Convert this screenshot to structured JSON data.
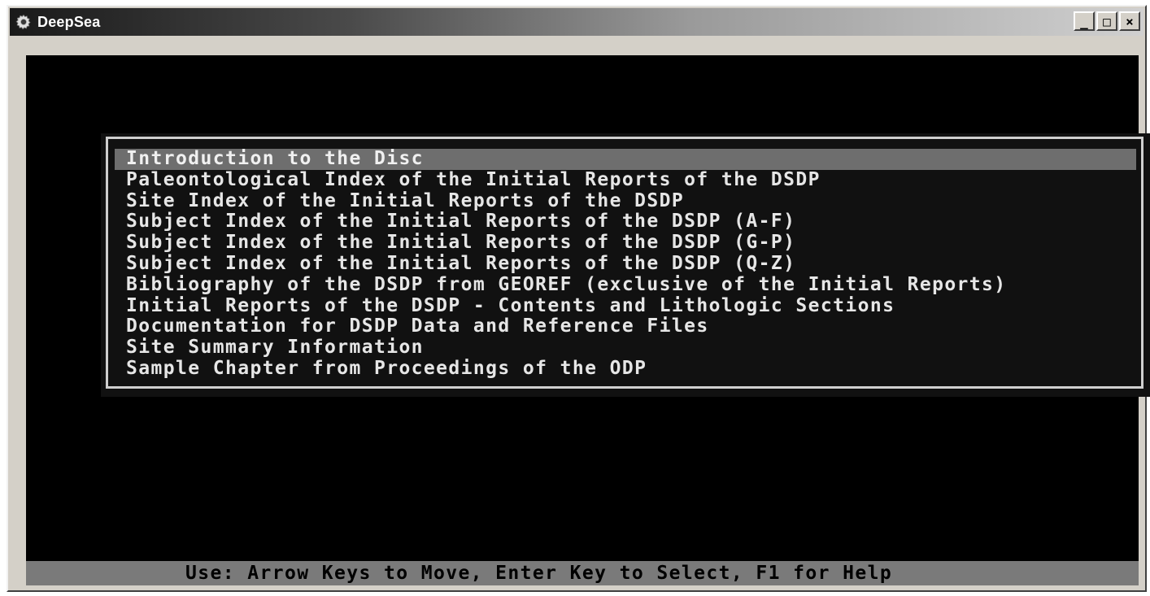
{
  "window": {
    "title": "DeepSea",
    "minimize_label": "_",
    "maximize_label": "□",
    "close_label": "×"
  },
  "menu": {
    "selected_index": 0,
    "items": [
      "Introduction to the Disc",
      "Paleontological Index of the Initial Reports of the DSDP",
      "Site Index of the Initial Reports of the DSDP",
      "Subject Index of the Initial Reports of the DSDP (A-F)",
      "Subject Index of the Initial Reports of the DSDP (G-P)",
      "Subject Index of the Initial Reports of the DSDP (Q-Z)",
      "Bibliography of the DSDP from GEOREF (exclusive of the Initial Reports)",
      "Initial Reports of the DSDP - Contents and Lithologic Sections",
      "Documentation for DSDP Data and Reference Files",
      "Site Summary Information",
      "Sample Chapter from Proceedings of the ODP"
    ]
  },
  "statusbar": {
    "text": "Use: Arrow Keys to Move, Enter Key to Select, F1 for Help"
  },
  "colors": {
    "console_background": "#000000",
    "console_text": "#e6e6e6",
    "selection_highlight": "#6e6e6e",
    "statusbar_background": "#7a7a7a"
  },
  "icons": {
    "app": "gear-icon"
  }
}
